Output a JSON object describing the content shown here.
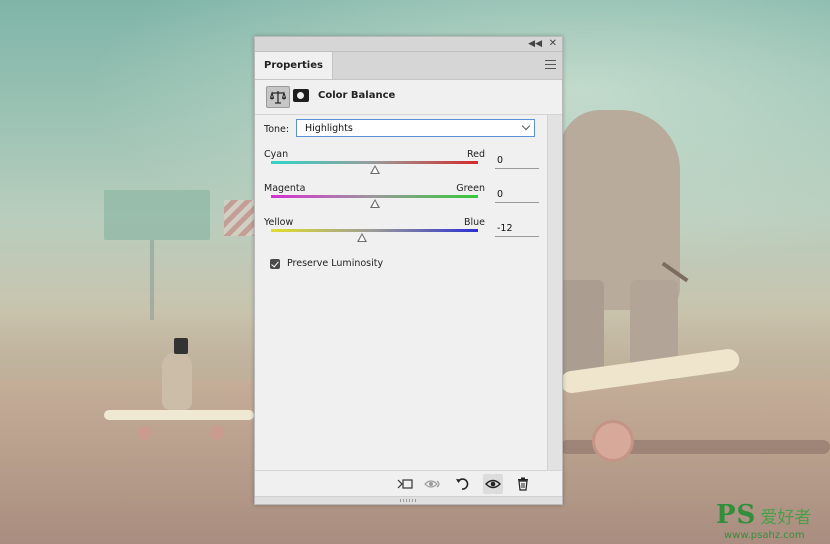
{
  "panel": {
    "tab_label": "Properties",
    "adjustment_title": "Color Balance",
    "adjustment_icon": "balance-scale-icon",
    "mask_icon": "layer-mask-icon"
  },
  "tone": {
    "label": "Tone:",
    "selected": "Highlights"
  },
  "sliders": [
    {
      "left": "Cyan",
      "right": "Red",
      "value": "0",
      "colors": [
        "#2ed6c9",
        "#d52a2a"
      ],
      "level": 0
    },
    {
      "left": "Magenta",
      "right": "Green",
      "value": "0",
      "colors": [
        "#d82fd3",
        "#35c83a"
      ],
      "level": 0
    },
    {
      "left": "Yellow",
      "right": "Blue",
      "value": "-12",
      "colors": [
        "#e0df2c",
        "#2a2fd0"
      ],
      "level": -12
    }
  ],
  "slider_range": [
    -100,
    100
  ],
  "preserve": {
    "label": "Preserve Luminosity",
    "checked": true
  },
  "bottom_icons": [
    "clip-to-layer-icon",
    "view-previous-state-icon",
    "reset-icon",
    "visibility-eye-icon",
    "delete-icon"
  ],
  "watermark": {
    "logo": "PS",
    "chinese": "爱好者",
    "url": "www.psahz.com"
  }
}
